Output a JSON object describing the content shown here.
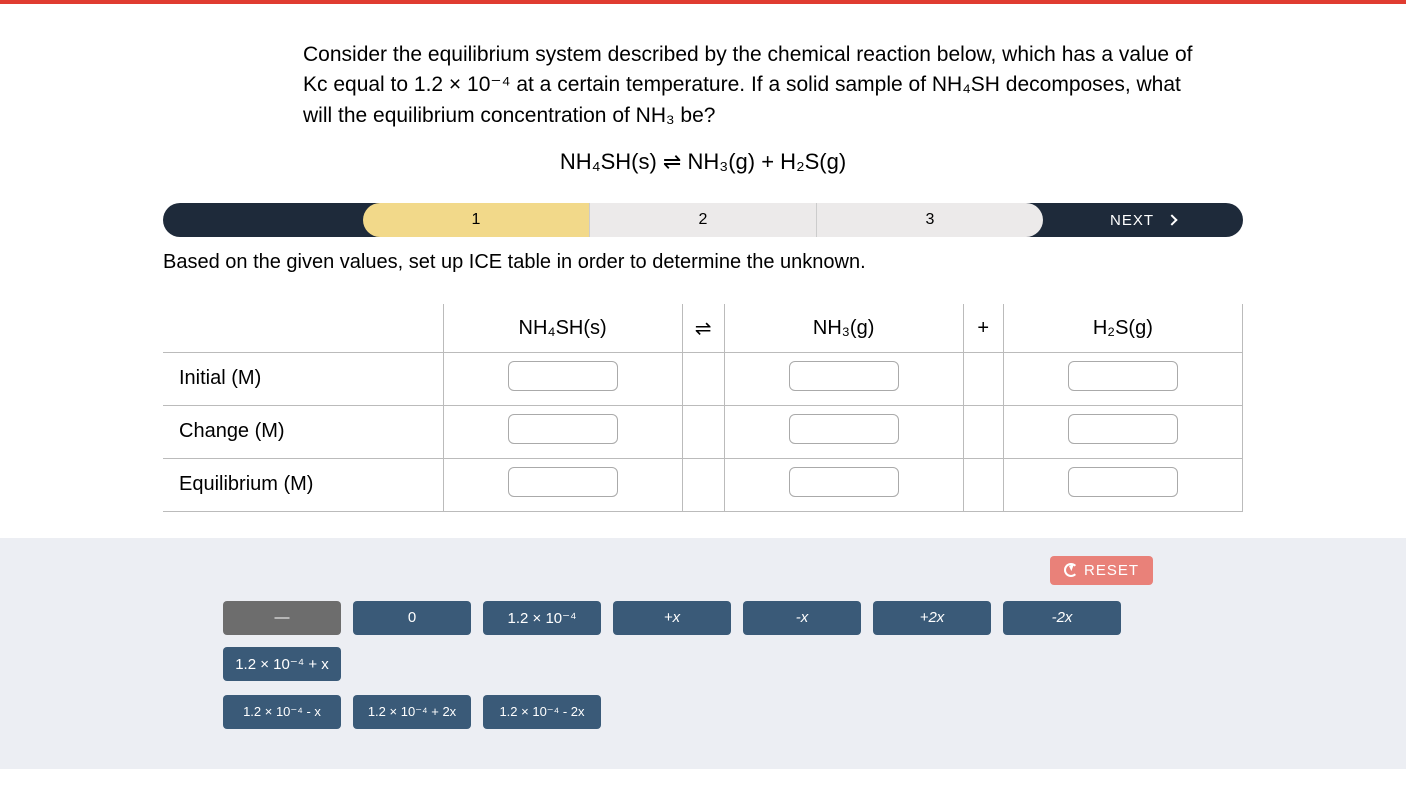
{
  "prompt": {
    "p1": "Consider the equilibrium system described by the chemical reaction below, which has a value of Kc equal to 1.2 × 10⁻⁴ at a certain temperature. If a solid sample of NH₄SH decomposes, what will the equilibrium concentration of NH₃ be?"
  },
  "equation": {
    "lhs": "NH₄SH(s)",
    "arrow": "⇌",
    "rhs": "NH₃(g) + H₂S(g)"
  },
  "steps": {
    "s1": "1",
    "s2": "2",
    "s3": "3",
    "next": "NEXT"
  },
  "instruction": "Based on the given values, set up ICE table in order to determine the unknown.",
  "table": {
    "headers": {
      "c1": "NH₄SH(s)",
      "op1": "⇌",
      "c2": "NH₃(g)",
      "op2": "+",
      "c3": "H₂S(g)"
    },
    "rows": {
      "r1": "Initial (M)",
      "r2": "Change (M)",
      "r3": "Equilibrium (M)"
    }
  },
  "reset": "RESET",
  "tiles": {
    "t0": "—",
    "t1": "0",
    "t2": "1.2 × 10⁻⁴",
    "t3": "+x",
    "t4": "-x",
    "t5": "+2x",
    "t6": "-2x",
    "t7": "1.2 × 10⁻⁴ + x",
    "t8": "1.2 × 10⁻⁴ - x",
    "t9": "1.2 × 10⁻⁴ + 2x",
    "t10": "1.2 × 10⁻⁴ - 2x"
  }
}
